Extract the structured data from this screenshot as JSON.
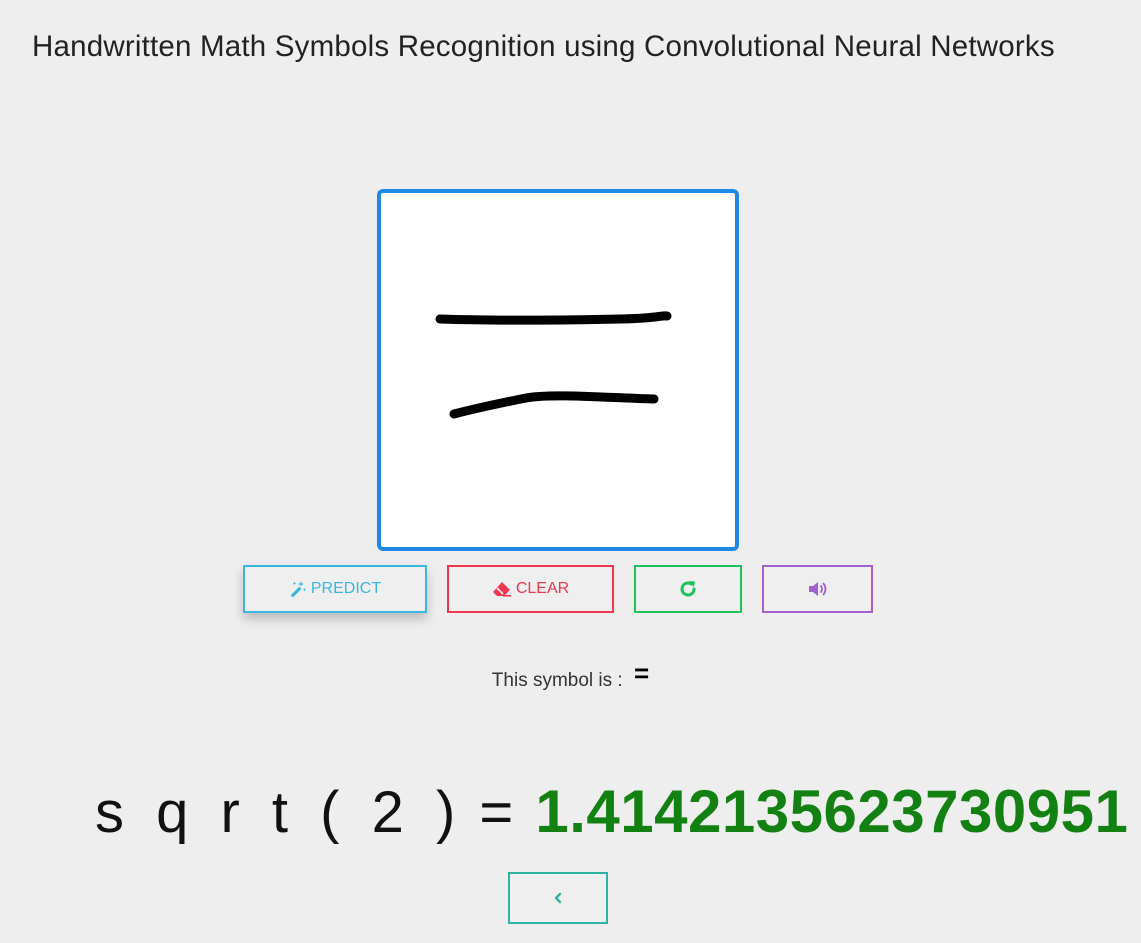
{
  "page": {
    "title": "Handwritten Math Symbols Recognition using Convolutional Neural Networks"
  },
  "buttons": {
    "predict_label": "PREDICT",
    "clear_label": "CLEAR"
  },
  "icons": {
    "predict": "magic-wand-icon",
    "clear": "eraser-icon",
    "redo": "refresh-icon",
    "sound": "speaker-icon",
    "back": "chevron-left-icon"
  },
  "result": {
    "label": "This symbol is :",
    "symbol": "="
  },
  "equation": {
    "expression": "s q r t ( 2 )",
    "equals": "=",
    "answer": "1.4142135623730951"
  },
  "colors": {
    "canvas_border": "#1e88e5",
    "predict": "#3bb6e0",
    "clear": "#f0384f",
    "redo": "#1fc25a",
    "sound": "#a45fd0",
    "back": "#2bb5a4",
    "answer": "#128112"
  }
}
